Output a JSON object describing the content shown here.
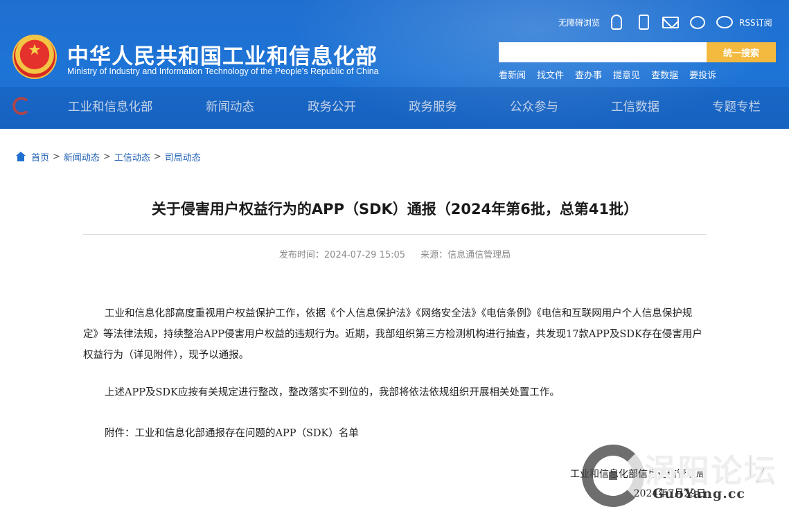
{
  "header": {
    "site_title": "中华人民共和国工业和信息化部",
    "site_subtitle": "Ministry of Industry and Information Technology of the People's Republic of China",
    "top_tools": {
      "accessibility": "无障碍浏览",
      "icons": [
        "robot-icon",
        "phone-icon",
        "mail-icon",
        "wechat-icon",
        "weibo-icon"
      ],
      "rss": "RSS订阅"
    },
    "search": {
      "placeholder": "",
      "button": "统一搜索"
    },
    "quick_links": [
      "看新闻",
      "找文件",
      "查办事",
      "提意见",
      "查数据",
      "要投诉"
    ],
    "nav": [
      "工业和信息化部",
      "新闻动态",
      "政务公开",
      "政务服务",
      "公众参与",
      "工信数据",
      "专题专栏"
    ]
  },
  "breadcrumb": [
    "首页",
    "新闻动态",
    "工信动态",
    "司局动态"
  ],
  "article": {
    "title": "关于侵害用户权益行为的APP（SDK）通报（2024年第6批，总第41批）",
    "meta_time_label": "发布时间：",
    "meta_time": "2024-07-29 15:05",
    "meta_source_label": "来源：",
    "meta_source": "信息通信管理局",
    "paragraphs": [
      "工业和信息化部高度重视用户权益保护工作，依据《个人信息保护法》《网络安全法》《电信条例》《电信和互联网用户个人信息保护规定》等法律法规，持续整治APP侵害用户权益的违规行为。近期，我部组织第三方检测机构进行抽查，共发现17款APP及SDK存在侵害用户权益行为（详见附件），现予以通报。",
      "上述APP及SDK应按有关规定进行整改，整改落实不到位的，我部将依法依规组织开展相关处置工作。",
      "附件：工业和信息化部通报存在问题的APP（SDK）名单"
    ],
    "signature_org": "工业和信息化部信息通信管理局",
    "signature_date": "2024年7月29日"
  },
  "watermark": {
    "title": "涡阳论坛",
    "url": "GuoYang.cc"
  }
}
